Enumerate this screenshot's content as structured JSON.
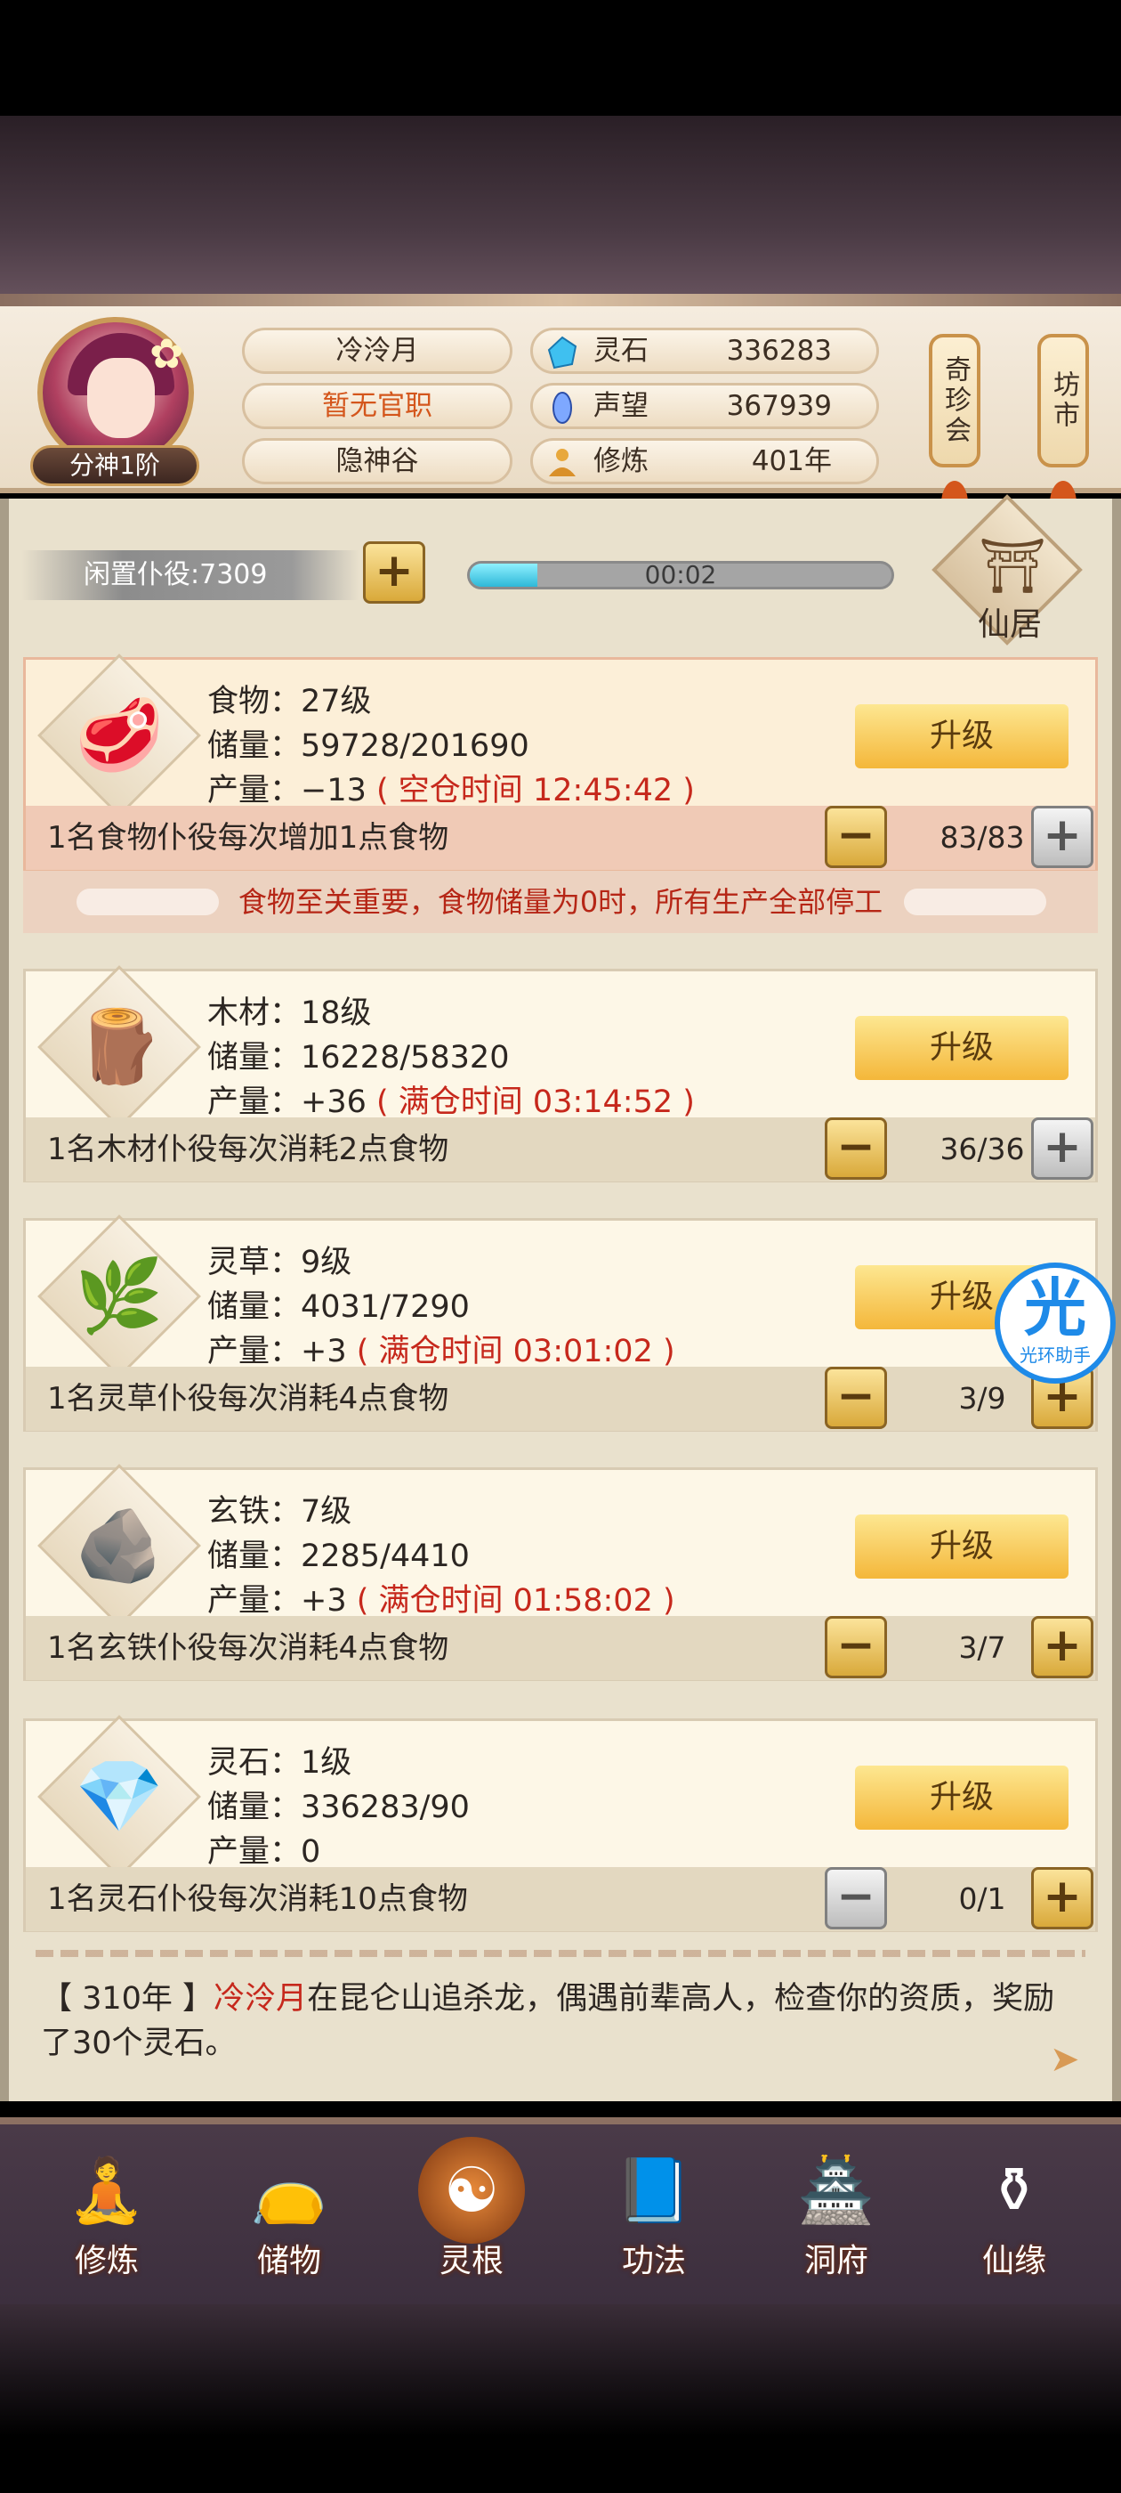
{
  "player": {
    "name": "冷泠月",
    "title": "暂无官职",
    "sect": "隐神谷",
    "rank": "分神1阶"
  },
  "resources": [
    {
      "label": "灵石",
      "value": "336283",
      "icon": "spirit-stone-icon"
    },
    {
      "label": "声望",
      "value": "367939",
      "icon": "reputation-icon"
    },
    {
      "label": "修炼",
      "value": "401年",
      "icon": "meditation-icon"
    }
  ],
  "side_buttons": {
    "treasure": "奇珍会",
    "market": "坊市"
  },
  "idle": {
    "label": "闲置仆役:7309",
    "timer": "00:02",
    "progress": 0.16
  },
  "xianju": {
    "label": "仙居"
  },
  "upgrade_label": "升级",
  "cards": [
    {
      "name_line": "食物：27级",
      "storage_line": "储量：59728/201690",
      "output_prefix": "产量：−13",
      "output_note": "( 空仓时间 12:45:42 )",
      "worker_text": "1名食物仆役每次增加1点食物",
      "count": "83/83",
      "icon": "meat-icon"
    },
    {
      "name_line": "木材：18级",
      "storage_line": "储量：16228/58320",
      "output_prefix": "产量：+36",
      "output_note": "( 满仓时间 03:14:52 )",
      "worker_text": "1名木材仆役每次消耗2点食物",
      "count": "36/36",
      "icon": "wood-icon"
    },
    {
      "name_line": "灵草：9级",
      "storage_line": "储量：4031/7290",
      "output_prefix": "产量：+3",
      "output_note": "( 满仓时间 03:01:02 )",
      "worker_text": "1名灵草仆役每次消耗4点食物",
      "count": "3/9",
      "icon": "herb-icon"
    },
    {
      "name_line": "玄铁：7级",
      "storage_line": "储量：2285/4410",
      "output_prefix": "产量：+3",
      "output_note": "( 满仓时间 01:58:02 )",
      "worker_text": "1名玄铁仆役每次消耗4点食物",
      "count": "3/7",
      "icon": "iron-ore-icon"
    },
    {
      "name_line": "灵石：1级",
      "storage_line": "储量：336283/90",
      "output_prefix": "产量：0",
      "output_note": "",
      "worker_text": "1名灵石仆役每次消耗10点食物",
      "count": "0/1",
      "icon": "spirit-stone-icon"
    }
  ],
  "warning": "食物至关重要，食物储量为0时，所有生产全部停工",
  "event": {
    "year": "【 310年 】",
    "name": "冷泠月",
    "text": "在昆仑山追杀龙，偶遇前辈高人，检查你的资质，奖励了30个灵石。"
  },
  "nav": [
    {
      "label": "修炼",
      "icon": "cultivate-icon",
      "glyph": "🧘"
    },
    {
      "label": "储物",
      "icon": "storage-bag-icon",
      "glyph": "👝"
    },
    {
      "label": "灵根",
      "icon": "spirit-root-icon",
      "glyph": "☯"
    },
    {
      "label": "功法",
      "icon": "scroll-book-icon",
      "glyph": "📘"
    },
    {
      "label": "洞府",
      "icon": "cave-palace-icon",
      "glyph": "🏯"
    },
    {
      "label": "仙缘",
      "icon": "gourd-icon",
      "glyph": "⚱"
    }
  ],
  "float_badge": {
    "char": "光",
    "label": "光环助手"
  }
}
